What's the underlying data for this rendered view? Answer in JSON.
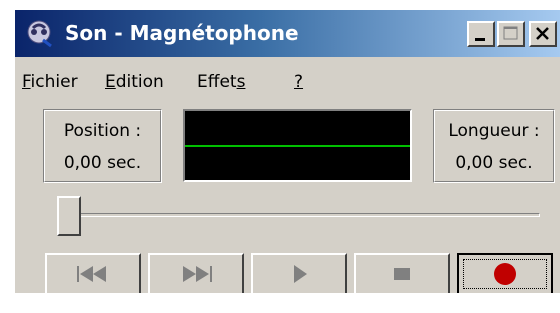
{
  "window": {
    "title": "Son - Magnétophone",
    "icon": "sound-recorder-icon"
  },
  "titlebar_buttons": [
    "minimize-icon",
    "maximize-icon",
    "close-icon"
  ],
  "menu": {
    "items": [
      {
        "accel": "F",
        "rest": "ichier"
      },
      {
        "accel": "E",
        "rest": "dition"
      },
      {
        "pre": "Effet",
        "accel": "s",
        "rest": ""
      },
      {
        "accel": "?",
        "rest": ""
      }
    ]
  },
  "position": {
    "label": "Position :",
    "value": "0,00 sec."
  },
  "length": {
    "label": "Longueur :",
    "value": "0,00 sec."
  },
  "waveform": {
    "line_color": "#00c000",
    "background": "#000000"
  },
  "seek": {
    "position_fraction": 0
  },
  "controls": [
    {
      "name": "rewind-button",
      "icon": "rewind-icon"
    },
    {
      "name": "fast-forward-button",
      "icon": "fast-forward-icon"
    },
    {
      "name": "play-button",
      "icon": "play-icon"
    },
    {
      "name": "stop-button",
      "icon": "stop-icon"
    },
    {
      "name": "record-button",
      "icon": "record-icon",
      "color": "#c00000"
    }
  ]
}
